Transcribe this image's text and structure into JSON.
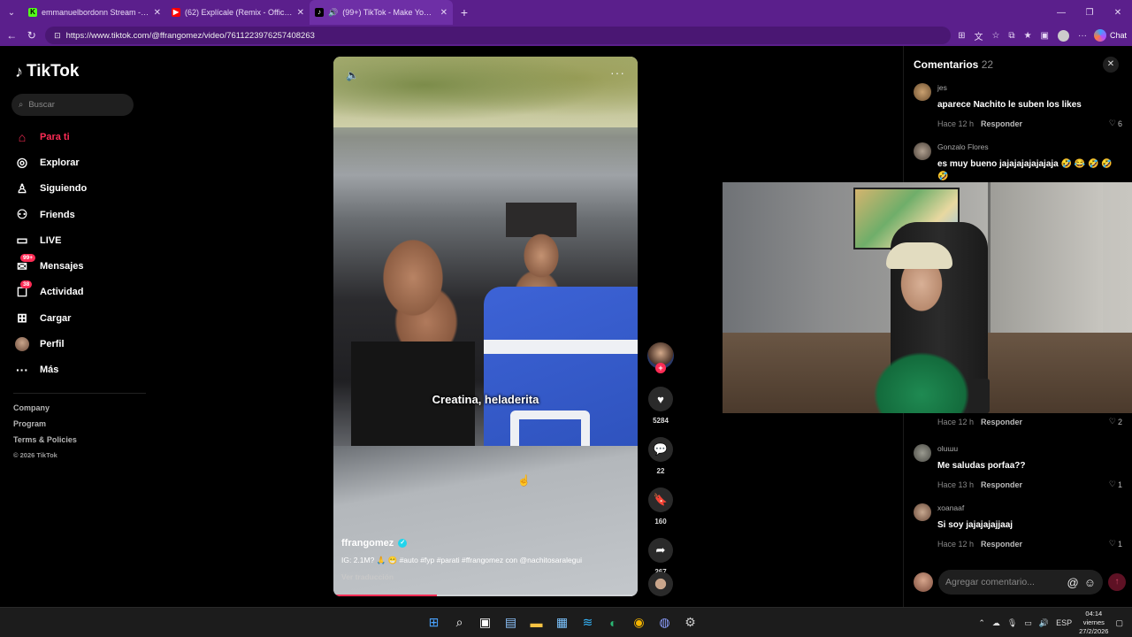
{
  "browser": {
    "tabs": [
      {
        "title": "emmanuelbordonn Stream - Watc",
        "icon": "kick-icon",
        "active": false
      },
      {
        "title": "(62) Explícale (Remix - Official Lyric",
        "icon": "youtube-icon",
        "active": false
      },
      {
        "title": "(99+) TikTok - Make Your Day",
        "icon": "tiktok-icon",
        "active": true
      }
    ],
    "url": "https://www.tiktok.com/@ffrangomez/video/7611223976257408263",
    "chat_label": "Chat"
  },
  "tiktok": {
    "logo_text": "TikTok",
    "search_placeholder": "Buscar",
    "nav": [
      {
        "label": "Para ti",
        "icon": "home-icon",
        "active": true
      },
      {
        "label": "Explorar",
        "icon": "compass-icon"
      },
      {
        "label": "Siguiendo",
        "icon": "following-icon"
      },
      {
        "label": "Friends",
        "icon": "friends-icon"
      },
      {
        "label": "LIVE",
        "icon": "live-tv-icon"
      },
      {
        "label": "Mensajes",
        "icon": "messages-icon",
        "badge": "99+"
      },
      {
        "label": "Actividad",
        "icon": "activity-icon",
        "badge": "38"
      },
      {
        "label": "Cargar",
        "icon": "upload-icon"
      },
      {
        "label": "Perfil",
        "icon": "profile-avatar"
      },
      {
        "label": "Más",
        "icon": "more-icon"
      }
    ],
    "footer": {
      "links": [
        "Company",
        "Program",
        "Terms & Policies"
      ],
      "copyright": "© 2026 TikTok"
    },
    "accent_color": "#fe2c55"
  },
  "video": {
    "caption_overlay": "Creatina, heladerita",
    "author": "ffrangomez",
    "description": "IG: 2.1M? 🙏 😁 #auto #fyp #parati #ffrangomez con @nachitosaralegui",
    "translate_label": "Ver traducción",
    "progress_percent": 34,
    "likes": "5284",
    "comments": "22",
    "saves": "160",
    "shares": "267"
  },
  "comments_panel": {
    "title": "Comentarios",
    "count": "22",
    "items": [
      {
        "user": "jes",
        "text": "aparece Nachito le suben los likes",
        "time": "Hace 12 h",
        "reply": "Responder",
        "likes": "6"
      },
      {
        "user": "Gonzalo Flores",
        "text": "es muy bueno jajajajajajajaja 🤣 😂 🤣 🤣 🤣",
        "time": "",
        "reply": "",
        "likes": ""
      },
      {
        "user": "",
        "text": "",
        "time": "Hace 12 h",
        "reply": "Responder",
        "likes": "2"
      },
      {
        "user": "oluɯu",
        "text": "Me saludas porfaa??",
        "time": "Hace 13 h",
        "reply": "Responder",
        "likes": "1"
      },
      {
        "user": "xoanaaf",
        "text": "Si soy jajajajajjaaj",
        "time": "Hace 12 h",
        "reply": "Responder",
        "likes": "1"
      }
    ],
    "input_placeholder": "Agregar comentario..."
  },
  "taskbar": {
    "language": "ESP",
    "time": "04:14",
    "day": "viernes",
    "date": "27/2/2026"
  }
}
